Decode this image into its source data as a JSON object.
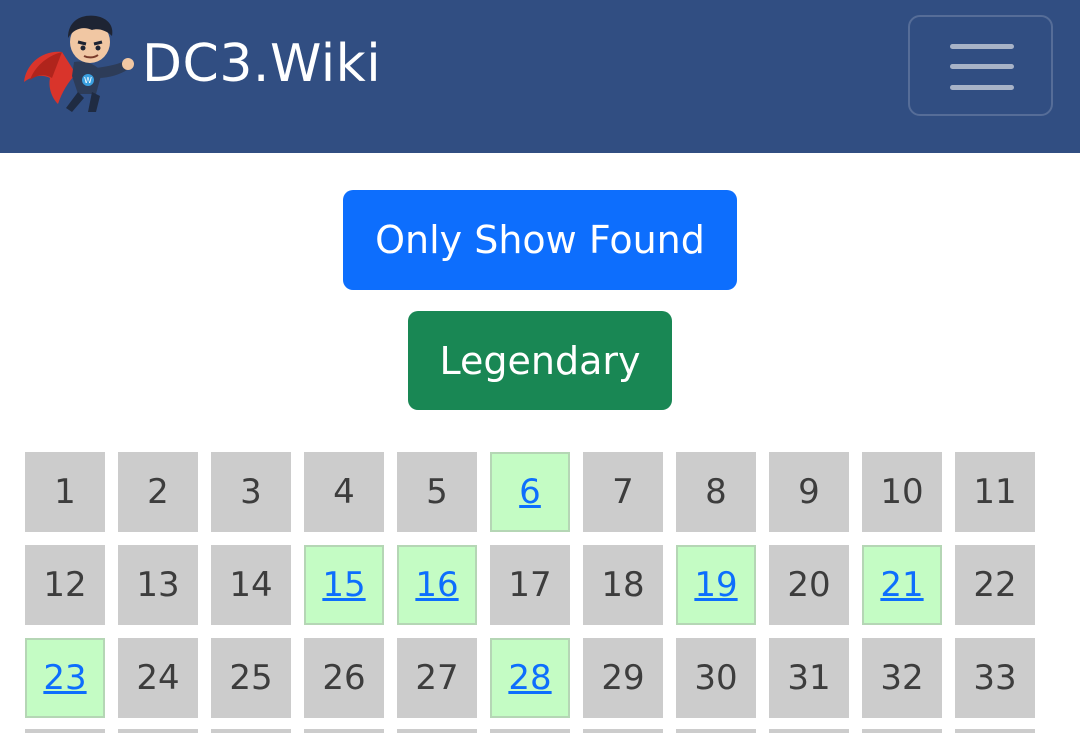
{
  "header": {
    "brand_text": "DC3.Wiki",
    "logo_icon": "superhero-mascot-icon",
    "menu_icon": "hamburger-menu-icon",
    "background_color": "#314e82"
  },
  "buttons": {
    "only_show_found": "Only Show Found",
    "legendary": "Legendary"
  },
  "colors": {
    "primary": "#0d6efd",
    "success": "#198754",
    "cell_default": "#cccccc",
    "cell_found": "#c4fcc4"
  },
  "grid": {
    "cells": [
      {
        "number": "1",
        "found": false
      },
      {
        "number": "2",
        "found": false
      },
      {
        "number": "3",
        "found": false
      },
      {
        "number": "4",
        "found": false
      },
      {
        "number": "5",
        "found": false
      },
      {
        "number": "6",
        "found": true
      },
      {
        "number": "7",
        "found": false
      },
      {
        "number": "8",
        "found": false
      },
      {
        "number": "9",
        "found": false
      },
      {
        "number": "10",
        "found": false
      },
      {
        "number": "11",
        "found": false
      },
      {
        "number": "12",
        "found": false
      },
      {
        "number": "13",
        "found": false
      },
      {
        "number": "14",
        "found": false
      },
      {
        "number": "15",
        "found": true
      },
      {
        "number": "16",
        "found": true
      },
      {
        "number": "17",
        "found": false
      },
      {
        "number": "18",
        "found": false
      },
      {
        "number": "19",
        "found": true
      },
      {
        "number": "20",
        "found": false
      },
      {
        "number": "21",
        "found": true
      },
      {
        "number": "22",
        "found": false
      },
      {
        "number": "23",
        "found": true
      },
      {
        "number": "24",
        "found": false
      },
      {
        "number": "25",
        "found": false
      },
      {
        "number": "26",
        "found": false
      },
      {
        "number": "27",
        "found": false
      },
      {
        "number": "28",
        "found": true
      },
      {
        "number": "29",
        "found": false
      },
      {
        "number": "30",
        "found": false
      },
      {
        "number": "31",
        "found": false
      },
      {
        "number": "32",
        "found": false
      },
      {
        "number": "33",
        "found": false
      }
    ]
  }
}
